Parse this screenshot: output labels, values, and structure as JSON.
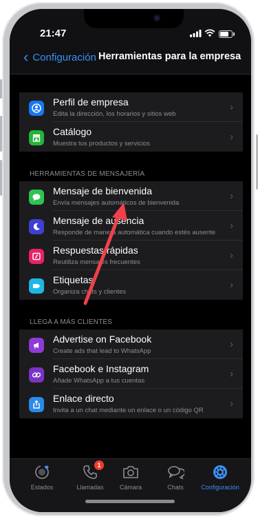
{
  "status": {
    "time": "21:47"
  },
  "nav": {
    "back_label": "Configuración",
    "title": "Herramientas para la empresa"
  },
  "groups": [
    {
      "header": "",
      "items": [
        {
          "title": "Perfil de empresa",
          "subtitle": "Edita la dirección, los horarios y sitios web",
          "icon": "profile-icon",
          "color": "#1877f2"
        },
        {
          "title": "Catálogo",
          "subtitle": "Muestra tus productos y servicios",
          "icon": "storefront-icon",
          "color": "#25b43a"
        }
      ]
    },
    {
      "header": "HERRAMIENTAS DE MENSAJERÍA",
      "items": [
        {
          "title": "Mensaje de bienvenida",
          "subtitle": "Envía mensajes automáticos de bienvenida",
          "icon": "chat-bubble-icon",
          "color": "#2ec353"
        },
        {
          "title": "Mensaje de ausencia",
          "subtitle": "Responde de manera automática cuando estés ausente",
          "icon": "moon-icon",
          "color": "#3f3fd1"
        },
        {
          "title": "Respuestas rápidas",
          "subtitle": "Reutiliza mensajes frecuentes",
          "icon": "quick-reply-icon",
          "color": "#e8206b"
        },
        {
          "title": "Etiquetas",
          "subtitle": "Organiza chats y clientes",
          "icon": "label-icon",
          "color": "#1fb6e6"
        }
      ]
    },
    {
      "header": "LLEGA A MÁS CLIENTES",
      "items": [
        {
          "title": "Advertise on Facebook",
          "subtitle": "Create ads that lead to WhatsApp",
          "icon": "megaphone-icon",
          "color": "#8e3ad6"
        },
        {
          "title": "Facebook e Instagram",
          "subtitle": "Añade WhatsApp a tus cuentas",
          "icon": "link-icon",
          "color": "#7a34c5"
        },
        {
          "title": "Enlace directo",
          "subtitle": "Invita a un chat mediante un enlace o un código QR",
          "icon": "share-icon",
          "color": "#2a8ae8"
        }
      ]
    }
  ],
  "tabs": [
    {
      "label": "Estados",
      "icon": "status-icon",
      "active": false
    },
    {
      "label": "Llamadas",
      "icon": "phone-icon",
      "active": false,
      "badge": "1"
    },
    {
      "label": "Cámara",
      "icon": "camera-icon",
      "active": false
    },
    {
      "label": "Chats",
      "icon": "chats-icon",
      "active": false
    },
    {
      "label": "Configuración",
      "icon": "settings-gear-icon",
      "active": true
    }
  ],
  "colors": {
    "accent": "#3b8ff5",
    "annotation_arrow": "#f0404a",
    "badge": "#f23b30"
  }
}
